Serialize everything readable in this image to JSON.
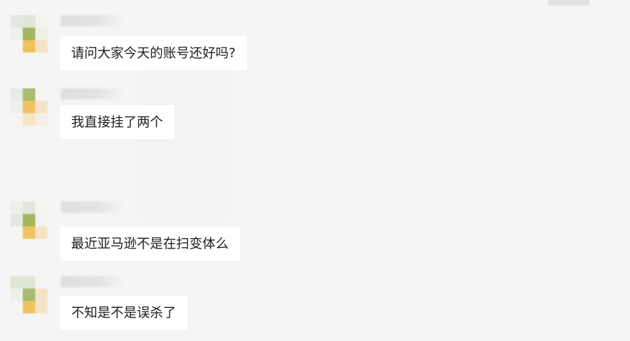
{
  "messages": [
    {
      "text": "请问大家今天的账号还好吗?"
    },
    {
      "text": "我直接挂了两个"
    },
    {
      "text": "最近亚马逊不是在扫变体么"
    },
    {
      "text": "不知是不是误杀了"
    }
  ],
  "colors": {
    "background": "#f5f5f5",
    "bubble": "#ffffff",
    "text": "#1e1e1e",
    "avatar_palette": [
      "#dfe6d6",
      "#9fb35a",
      "#f1c05a",
      "#f4e3c4",
      "#eef0ea"
    ]
  }
}
